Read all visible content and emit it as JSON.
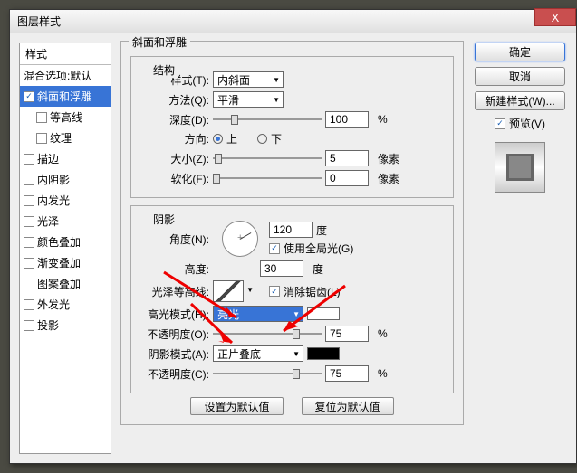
{
  "window": {
    "title": "图层样式"
  },
  "buttons": {
    "ok": "确定",
    "cancel": "取消",
    "newstyle": "新建样式(W)...",
    "preview": "预览(V)",
    "reset": "设置为默认值",
    "restore": "复位为默认值",
    "close": "X"
  },
  "left": {
    "header": "样式",
    "blend": "混合选项:默认",
    "bevel": "斜面和浮雕",
    "contour": "等高线",
    "texture": "纹理",
    "stroke": "描边",
    "innershadow": "内阴影",
    "innerglow": "内发光",
    "satin": "光泽",
    "coloroverlay": "颜色叠加",
    "gradientoverlay": "渐变叠加",
    "patternoverlay": "图案叠加",
    "outerglow": "外发光",
    "dropshadow": "投影"
  },
  "bevel": {
    "title": "斜面和浮雕",
    "structure": "结构",
    "style_l": "样式(T):",
    "style_v": "内斜面",
    "tech_l": "方法(Q):",
    "tech_v": "平滑",
    "depth_l": "深度(D):",
    "depth_v": "100",
    "depth_u": "%",
    "dir_l": "方向:",
    "up": "上",
    "down": "下",
    "size_l": "大小(Z):",
    "size_v": "5",
    "size_u": "像素",
    "soft_l": "软化(F):",
    "soft_v": "0",
    "soft_u": "像素"
  },
  "shading": {
    "title": "阴影",
    "angle_l": "角度(N):",
    "angle_v": "120",
    "angle_u": "度",
    "global": "使用全局光(G)",
    "alt_l": "高度:",
    "alt_v": "30",
    "alt_u": "度",
    "gloss_l": "光泽等高线:",
    "antialias": "消除锯齿(L)",
    "hl_l": "高光模式(H):",
    "hl_v": "亮光",
    "hlop_l": "不透明度(O):",
    "hlop_v": "75",
    "hlop_u": "%",
    "sh_l": "阴影模式(A):",
    "sh_v": "正片叠底",
    "shop_l": "不透明度(C):",
    "shop_v": "75",
    "shop_u": "%"
  }
}
